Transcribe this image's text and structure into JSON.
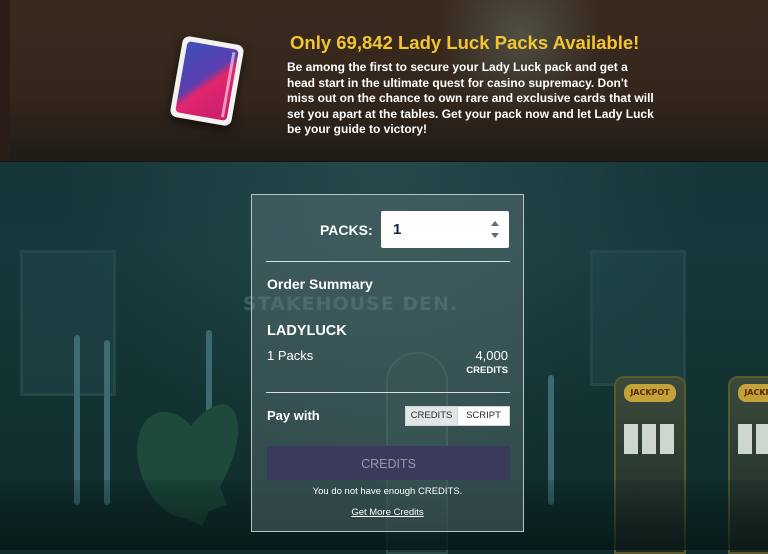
{
  "banner": {
    "title": "Only 69,842  Lady Luck Packs Available!",
    "description": "Be among the first to secure your Lady Luck pack and get a head start in the ultimate quest for casino supremacy. Don't miss out on the chance to own rare and exclusive cards that will set you apart at the tables. Get your pack now and let Lady Luck be your guide to victory!"
  },
  "background": {
    "sign_text": "STAKEHOUSE DEN.",
    "slot_label": "JACKPOT"
  },
  "order": {
    "packs_label": "PACKS:",
    "packs_value": "1",
    "summary_heading": "Order Summary",
    "product_name": "LADYLUCK",
    "pack_count": "1 Packs",
    "price": "4,000",
    "price_unit": "CREDITS",
    "pay_with_label": "Pay with",
    "payment_options": [
      "CREDITS",
      "SCRIPT"
    ],
    "selected_payment": "CREDITS",
    "submit_label": "CREDITS",
    "warning": "You do not have enough CREDITS.",
    "get_more_link": "Get More Credits"
  },
  "colors": {
    "title_gold": "#f2c531",
    "button_bg": "#3c3a5c",
    "button_text": "#9698ad"
  }
}
